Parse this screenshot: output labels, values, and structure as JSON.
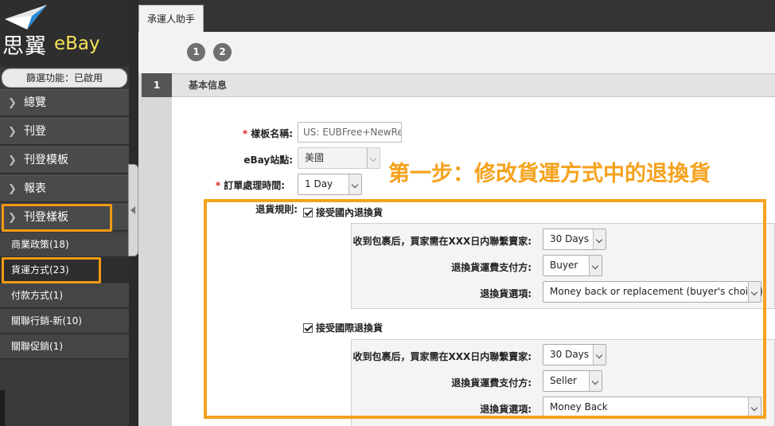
{
  "brand": {
    "name_cn": "思翼",
    "name_en": "eBay"
  },
  "sidebar": {
    "filter_status": "篩選功能：已啟用",
    "nav": [
      {
        "label": "總覽"
      },
      {
        "label": "刊登"
      },
      {
        "label": "刊登模板"
      },
      {
        "label": "報表"
      },
      {
        "label": "刊登樣板"
      }
    ],
    "sub": [
      {
        "label": "商業政策(18)"
      },
      {
        "label": "貨運方式(23)"
      },
      {
        "label": "付款方式(1)"
      },
      {
        "label": "關聯行銷-新(10)"
      },
      {
        "label": "關聯促銷(1)"
      }
    ]
  },
  "tab": {
    "label": "承運人助手"
  },
  "steps": [
    "1",
    "2"
  ],
  "section": {
    "number": "1",
    "title": "基本信息"
  },
  "form": {
    "template_name": {
      "label": "樣板名稱:",
      "value": "US: EUBFree+NewRe"
    },
    "ebay_site": {
      "label": "eBay站點:",
      "value": "美國"
    },
    "handling_time": {
      "label": "訂單處理時間:",
      "value": "1 Day"
    },
    "return_policy_label": "退貨規則:",
    "domestic": {
      "checkbox_label": "接受國內退換貨",
      "within": {
        "label": "收到包裹后，買家需在XXX日内聯繫賣家:",
        "value": "30 Days"
      },
      "shipping_paid_by": {
        "label": "退換貨運費支付方:",
        "value": "Buyer"
      },
      "option": {
        "label": "退換貨選項:",
        "value": "Money back or replacement (buyer's choice)"
      }
    },
    "international": {
      "checkbox_label": "接受國際退換貨",
      "within": {
        "label": "收到包裹后，買家需在XXX日内聯繫賣家:",
        "value": "30 Days"
      },
      "shipping_paid_by": {
        "label": "退換貨運費支付方:",
        "value": "Seller"
      },
      "option": {
        "label": "退換貨選項:",
        "value": "Money Back"
      }
    }
  },
  "annotation": {
    "text": "第一步：修改貨運方式中的退換貨",
    "color": "#f5a21d"
  },
  "colors": {
    "highlight": "#f29a12",
    "required": "#dd2222",
    "sidebar": "#3a3a3a"
  }
}
